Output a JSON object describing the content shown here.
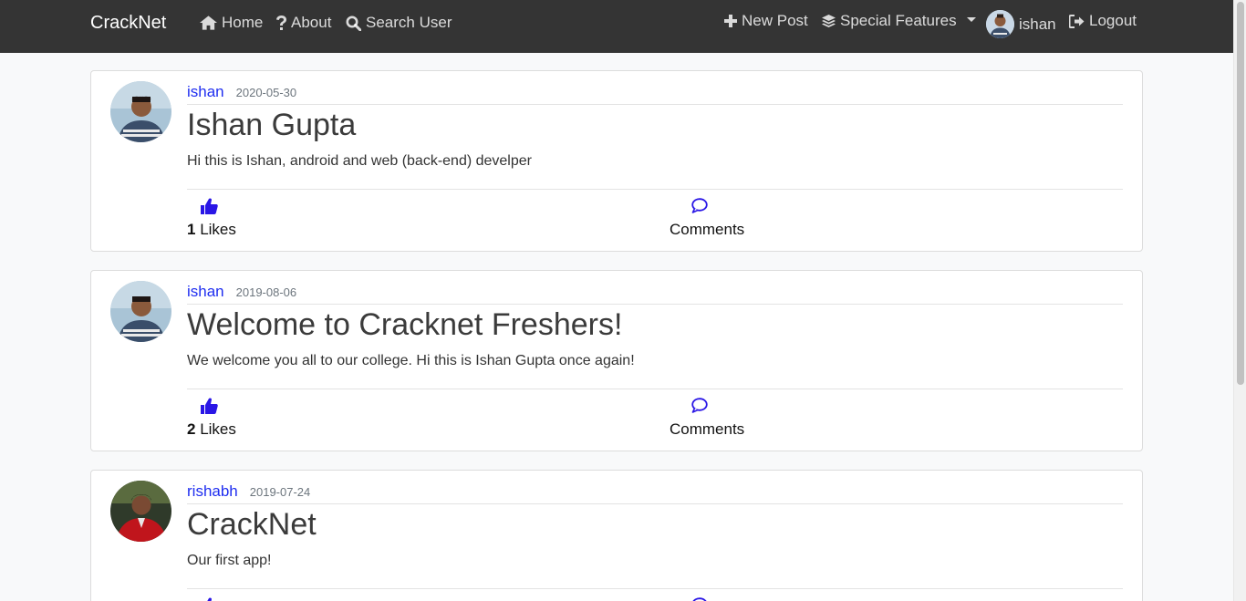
{
  "navbar": {
    "brand": "CrackNet",
    "home": "Home",
    "about": "About",
    "search_user": "Search User",
    "new_post": "New Post",
    "special_features": "Special Features",
    "username": "ishan",
    "logout": "Logout"
  },
  "posts": [
    {
      "author": "ishan",
      "date": "2020-05-30",
      "title": "Ishan Gupta",
      "body": "Hi this is Ishan, android and web (back-end) develper",
      "likes_count": "1",
      "likes_label": "Likes",
      "comments_label": "Comments"
    },
    {
      "author": "ishan",
      "date": "2019-08-06",
      "title": "Welcome to Cracknet Freshers!",
      "body": "We welcome you all to our college. Hi this is Ishan Gupta once again!",
      "likes_count": "2",
      "likes_label": "Likes",
      "comments_label": "Comments"
    },
    {
      "author": "rishabh",
      "date": "2019-07-24",
      "title": "CrackNet",
      "body": "Our first app!",
      "likes_count": "",
      "likes_label": "",
      "comments_label": ""
    }
  ],
  "colors": {
    "navbar_bg": "#343434",
    "link_blue": "#1f2ef0",
    "icon_blue": "#2a16e6"
  }
}
